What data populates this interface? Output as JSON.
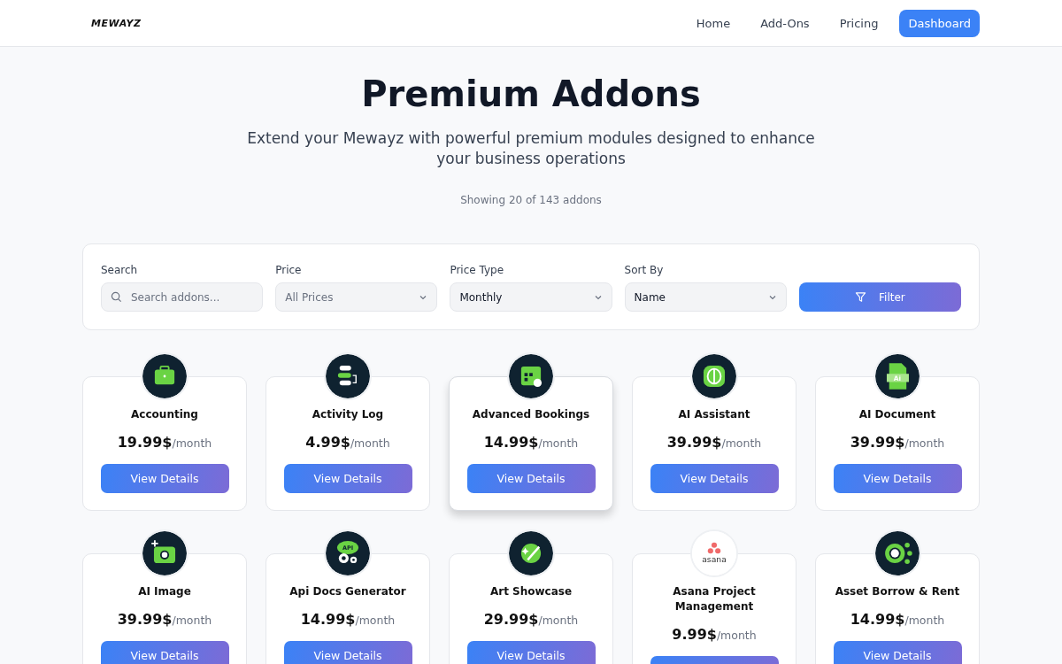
{
  "header": {
    "logo": "MEWAYZ",
    "nav": [
      {
        "label": "Home",
        "kind": "link"
      },
      {
        "label": "Add-Ons",
        "kind": "link"
      },
      {
        "label": "Pricing",
        "kind": "link"
      },
      {
        "label": "Dashboard",
        "kind": "primary"
      }
    ]
  },
  "hero": {
    "title": "Premium Addons",
    "subtitle": "Extend your Mewayz with powerful premium modules designed to enhance your business operations",
    "count": "Showing 20 of 143 addons"
  },
  "filters": {
    "search": {
      "label": "Search",
      "placeholder": "Search addons..."
    },
    "selects": [
      {
        "label": "Price",
        "value": "All Prices",
        "placeholder": true
      },
      {
        "label": "Price Type",
        "value": "Monthly",
        "placeholder": false
      },
      {
        "label": "Sort By",
        "value": "Name",
        "placeholder": false
      }
    ],
    "button": "Filter"
  },
  "addons": [
    {
      "name": "Accounting",
      "price": "19.99$",
      "period": "/month",
      "kind": "briefcase",
      "button": "View Details",
      "highlighted": false
    },
    {
      "name": "Activity Log",
      "price": "4.99$",
      "period": "/month",
      "kind": "log",
      "button": "View Details",
      "highlighted": false
    },
    {
      "name": "Advanced Bookings",
      "price": "14.99$",
      "period": "/month",
      "kind": "calendar",
      "button": "View Details",
      "highlighted": true
    },
    {
      "name": "AI Assistant",
      "price": "39.99$",
      "period": "/month",
      "kind": "brain",
      "button": "View Details",
      "highlighted": false
    },
    {
      "name": "AI Document",
      "price": "39.99$",
      "period": "/month",
      "kind": "document",
      "icon_text": "Ai",
      "button": "View Details",
      "highlighted": false
    },
    {
      "name": "AI Image",
      "price": "39.99$",
      "period": "/month",
      "kind": "camera",
      "button": "View Details",
      "highlighted": false
    },
    {
      "name": "Api Docs Generator",
      "price": "14.99$",
      "period": "/month",
      "kind": "api",
      "icon_text": "API",
      "button": "View Details",
      "highlighted": false
    },
    {
      "name": "Art Showcase",
      "price": "29.99$",
      "period": "/month",
      "kind": "art",
      "button": "View Details",
      "highlighted": false
    },
    {
      "name": "Asana Project Management",
      "price": "9.99$",
      "period": "/month",
      "kind": "asana",
      "icon_text": "asana",
      "highlighted": false
    },
    {
      "name": "Asset Borrow & Rent",
      "price": "14.99$",
      "period": "/month",
      "kind": "asset",
      "button": "View Details",
      "highlighted": false
    }
  ]
}
